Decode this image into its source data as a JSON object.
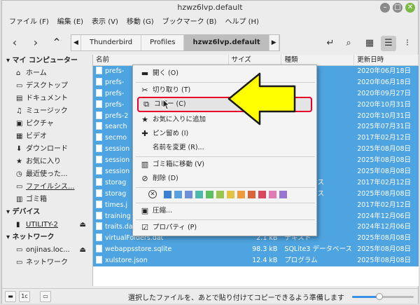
{
  "window": {
    "title": "hzwz6lvp.default"
  },
  "menubar": [
    "ファイル (F)",
    "編集 (E)",
    "表示 (V)",
    "移動 (G)",
    "ブックマーク (B)",
    "ヘルプ (H)"
  ],
  "breadcrumbs": [
    "Thunderbird",
    "Profiles",
    "hzwz6lvp.default"
  ],
  "sidebar": {
    "sections": [
      {
        "title": "マイ コンピューター",
        "items": [
          {
            "icon": "home-icon",
            "glyph": "⌂",
            "label": "ホーム"
          },
          {
            "icon": "desktop-icon",
            "glyph": "▭",
            "label": "デスクトップ"
          },
          {
            "icon": "documents-icon",
            "glyph": "▤",
            "label": "ドキュメント"
          },
          {
            "icon": "music-icon",
            "glyph": "♫",
            "label": "ミュージック"
          },
          {
            "icon": "pictures-icon",
            "glyph": "▣",
            "label": "ピクチャ"
          },
          {
            "icon": "videos-icon",
            "glyph": "▦",
            "label": "ビデオ"
          },
          {
            "icon": "download-icon",
            "glyph": "⬇",
            "label": "ダウンロード"
          },
          {
            "icon": "favorites-icon",
            "glyph": "★",
            "label": "お気に入り"
          },
          {
            "icon": "recent-icon",
            "glyph": "◷",
            "label": "最近使った..."
          },
          {
            "icon": "filesystem-icon",
            "glyph": "▭",
            "label": "ファイルシス..."
          },
          {
            "icon": "trash-icon",
            "glyph": "▥",
            "label": "ゴミ箱"
          }
        ]
      },
      {
        "title": "デバイス",
        "items": [
          {
            "icon": "usb-drive-icon",
            "glyph": "▮",
            "label": "UTILITY-2",
            "eject": "⏏"
          }
        ]
      },
      {
        "title": "ネットワーク",
        "items": [
          {
            "icon": "network-share-icon",
            "glyph": "▭",
            "label": "onjinas.loc...",
            "eject": "⏏"
          },
          {
            "icon": "network-icon",
            "glyph": "▭",
            "label": "ネットワーク"
          }
        ]
      }
    ]
  },
  "columns": {
    "name": "名前",
    "size": "サイズ",
    "type": "種類",
    "date": "更新日時"
  },
  "files": [
    {
      "name": "prefs-",
      "size": "",
      "type": "",
      "date": "2020年06月18日"
    },
    {
      "name": "prefs-",
      "size": "",
      "type": "",
      "date": "2020年06月18日"
    },
    {
      "name": "prefs-",
      "size": "",
      "type": "",
      "date": "2020年09月27日"
    },
    {
      "name": "prefs-",
      "size": "",
      "type": "",
      "date": "2020年10月31日"
    },
    {
      "name": "prefs-2",
      "size": "",
      "type": "",
      "date": "2020年10月31日"
    },
    {
      "name": "search",
      "size": "",
      "type": "",
      "date": "2025年07月31日"
    },
    {
      "name": "secmo",
      "size": "",
      "type": "",
      "date": "2017年02月12日"
    },
    {
      "name": "session",
      "size": "",
      "type": "",
      "date": "2025年08月08日"
    },
    {
      "name": "session",
      "size": "",
      "type": "",
      "date": "2025年08月08日"
    },
    {
      "name": "session",
      "size": "",
      "type": "",
      "date": "2025年08月08日"
    },
    {
      "name": "storag",
      "size": "",
      "type": "データベース",
      "date": "2017年02月12日"
    },
    {
      "name": "storag",
      "size": "",
      "type": "データベース",
      "date": "2025年08月08日"
    },
    {
      "name": "times.j",
      "size": "",
      "type": "",
      "date": "2017年02月12日"
    },
    {
      "name": "training",
      "size": "",
      "type": "",
      "date": "2024年12月06日"
    },
    {
      "name": "traits.dat",
      "size": "8 bytes",
      "type": "バイナリ",
      "date": "2024年12月06日"
    },
    {
      "name": "virtualFolders.dat",
      "size": "2.1 kB",
      "type": "テキスト",
      "date": "2025年08月08日"
    },
    {
      "name": "webappsstore.sqlite",
      "size": "98.3 kB",
      "type": "SQLite3 データベース",
      "date": "2025年08月08日"
    },
    {
      "name": "xulstore.json",
      "size": "12.4 kB",
      "type": "プログラム",
      "date": "2025年08月08日"
    }
  ],
  "context_menu": {
    "items": [
      {
        "name": "open",
        "icon": "folder-open-icon",
        "glyph": "▬",
        "label": "開く (O)"
      },
      {
        "name": "cut",
        "icon": "scissors-icon",
        "glyph": "✂",
        "label": "切り取り (T)"
      },
      {
        "name": "copy",
        "icon": "copy-icon",
        "glyph": "⧉",
        "label": "コピー (C)"
      },
      {
        "name": "add-favorite",
        "icon": "star-icon",
        "glyph": "★",
        "label": "お気に入りに追加"
      },
      {
        "name": "pin",
        "icon": "pin-icon",
        "glyph": "✚",
        "label": "ピン留め (I)"
      },
      {
        "name": "rename",
        "icon": "",
        "glyph": "",
        "label": "名前を変更 (R)..."
      },
      {
        "name": "move-to-trash",
        "icon": "trash-icon",
        "glyph": "▥",
        "label": "ゴミ箱に移動 (V)"
      },
      {
        "name": "delete",
        "icon": "delete-icon",
        "glyph": "⊘",
        "label": "削除 (D)"
      },
      {
        "name": "compress",
        "icon": "archive-icon",
        "glyph": "▣",
        "label": "圧縮..."
      },
      {
        "name": "properties",
        "icon": "properties-icon",
        "glyph": "☑",
        "label": "プロパティ (P)"
      }
    ],
    "tag_colors": [
      "#3d7fd1",
      "#5aa0dc",
      "#6c8fd6",
      "#4bb8a9",
      "#5cbf5e",
      "#9bc54c",
      "#e3c33f",
      "#ef9b3c",
      "#d9633b",
      "#d94660",
      "#e07bb4",
      "#9a74d1"
    ]
  },
  "statusbar": {
    "message": "選択したファイルを、あとで貼り付けてコピーできるよう準備します"
  },
  "colors": {
    "selection": "#4ea4e0",
    "highlight_border": "#e8002b",
    "arrow_fill": "#ffff00"
  }
}
